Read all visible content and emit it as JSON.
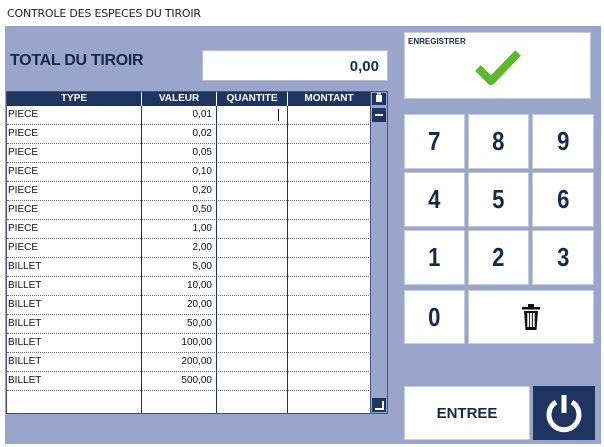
{
  "window": {
    "title": "CONTROLE DES ESPECES DU TIROIR"
  },
  "total": {
    "label": "TOTAL DU TIROIR",
    "value": "0,00"
  },
  "grid": {
    "columns": [
      "TYPE",
      "VALEUR",
      "QUANTITE",
      "MONTANT"
    ],
    "rows": [
      {
        "type": "PIECE",
        "value": "0,01",
        "quantity": "",
        "amount": ""
      },
      {
        "type": "PIECE",
        "value": "0,02",
        "quantity": "",
        "amount": ""
      },
      {
        "type": "PIECE",
        "value": "0,05",
        "quantity": "",
        "amount": ""
      },
      {
        "type": "PIECE",
        "value": "0,10",
        "quantity": "",
        "amount": ""
      },
      {
        "type": "PIECE",
        "value": "0,20",
        "quantity": "",
        "amount": ""
      },
      {
        "type": "PIECE",
        "value": "0,50",
        "quantity": "",
        "amount": ""
      },
      {
        "type": "PIECE",
        "value": "1,00",
        "quantity": "",
        "amount": ""
      },
      {
        "type": "PIECE",
        "value": "2,00",
        "quantity": "",
        "amount": ""
      },
      {
        "type": "BILLET",
        "value": "5,00",
        "quantity": "",
        "amount": ""
      },
      {
        "type": "BILLET",
        "value": "10,00",
        "quantity": "",
        "amount": ""
      },
      {
        "type": "BILLET",
        "value": "20,00",
        "quantity": "",
        "amount": ""
      },
      {
        "type": "BILLET",
        "value": "50,00",
        "quantity": "",
        "amount": ""
      },
      {
        "type": "BILLET",
        "value": "100,00",
        "quantity": "",
        "amount": ""
      },
      {
        "type": "BILLET",
        "value": "200,00",
        "quantity": "",
        "amount": ""
      },
      {
        "type": "BILLET",
        "value": "500,00",
        "quantity": "",
        "amount": ""
      }
    ]
  },
  "keypad": {
    "save_label": "ENREGISTRER",
    "save_icon": "check-icon",
    "digits": [
      "7",
      "8",
      "9",
      "4",
      "5",
      "6",
      "1",
      "2",
      "3",
      "0"
    ],
    "delete_icon": "trash-icon",
    "enter_label": "ENTREE",
    "power_icon": "power-icon"
  },
  "colors": {
    "panel": "#9aa5cb",
    "navy": "#1e3561",
    "text": "#132a4e",
    "check": "#5cb82a"
  }
}
